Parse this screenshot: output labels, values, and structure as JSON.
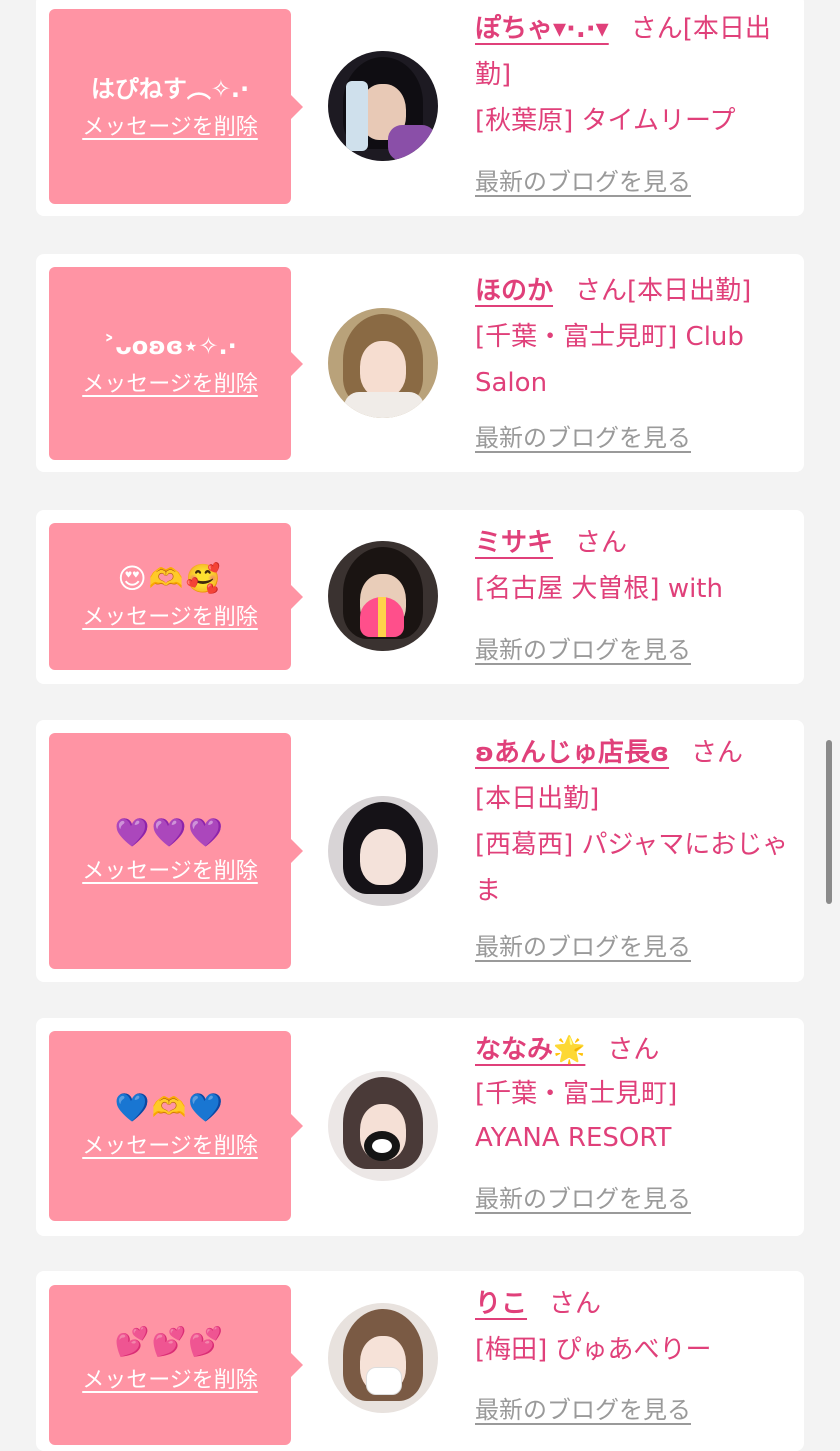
{
  "delete_label": "メッセージを削除",
  "honorific": "さん",
  "blog_label": "最新のブログを見る",
  "colors": {
    "bubble": "#ff94a4",
    "accent": "#e0407a",
    "link_gray": "#9a9a9a",
    "card": "#ffffff",
    "background": "#f3f3f3"
  },
  "cards": [
    {
      "message": "はぴねす︵✧.·",
      "name": "ぽちゃ▾·.·▾",
      "status": "[本日出勤]",
      "location": "[秋葉原] タイムリープ",
      "avatar_icon": "avatar-photo-glasses"
    },
    {
      "message": "˃ᴗoʚɞ⋆✧.·",
      "name": "ほのか",
      "status": "[本日出勤]",
      "location": "[千葉・富士見町] Club Salon",
      "avatar_icon": "avatar-photo-blonde"
    },
    {
      "message": "😍🫶🥰",
      "name": "ミサキ",
      "status": "",
      "location": "[名古屋 大曽根] with",
      "avatar_icon": "avatar-photo-heart-sticker"
    },
    {
      "message": "💜💜💜",
      "name": "ʚあんじゅ店長ɞ",
      "status": "[本日出勤]",
      "location": "[西葛西] パジャマにおじゃま",
      "avatar_icon": "avatar-photo-black-hair"
    },
    {
      "message": "💙🫶💙",
      "name": "ななみ🌟",
      "status": "",
      "location": "[千葉・富士見町] AYANA RESORT",
      "avatar_icon": "avatar-photo-mascot-sticker"
    },
    {
      "message": "💕💕💕",
      "name": "りこ",
      "status": "",
      "location": "[梅田] ぴゅあべりー",
      "avatar_icon": "avatar-photo-mask"
    }
  ]
}
